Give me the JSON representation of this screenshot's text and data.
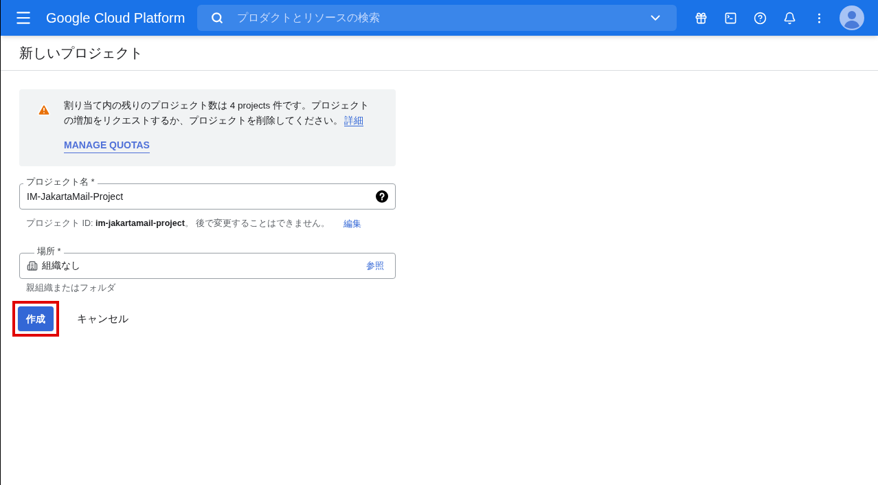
{
  "header": {
    "product_name": "Google Cloud Platform",
    "search": {
      "placeholder": "プロダクトとリソースの検索"
    }
  },
  "page_title": "新しいプロジェクト",
  "quota_notice": {
    "text": "割り当て内の残りのプロジェクト数は 4 projects 件です。プロジェクトの増加をリクエストするか、プロジェクトを削除してください。",
    "link": "詳細",
    "action": "MANAGE QUOTAS"
  },
  "project_name_field": {
    "label": "プロジェクト名 *",
    "value": "IM-JakartaMail-Project"
  },
  "project_id_hint": {
    "text": "プロジェクト ID: **im-jakartamail-project**。 後で変更することはできません。",
    "link": "編集"
  },
  "location_field": {
    "label": "場所 *",
    "value": "組織なし",
    "action": "参照"
  },
  "location_hint": "親組織またはフォルダ",
  "buttons": [
    {
      "label": "作成",
      "kind": "primary",
      "highlighted": true
    },
    {
      "label": "キャンセル",
      "kind": "text",
      "highlighted": false
    }
  ]
}
